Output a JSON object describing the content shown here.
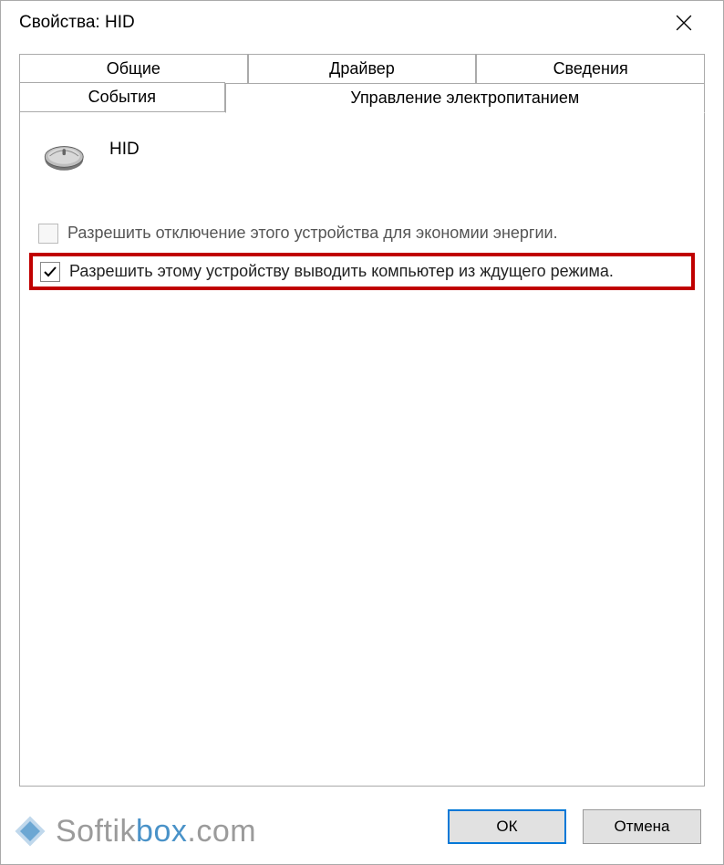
{
  "titlebar": {
    "title": "Свойства: HID"
  },
  "tabs": {
    "general": "Общие",
    "driver": "Драйвер",
    "details": "Сведения",
    "events": "События",
    "power": "Управление электропитанием"
  },
  "device": {
    "name": "HID"
  },
  "options": {
    "allow_turn_off": {
      "checked": false,
      "label": "Разрешить отключение этого устройства для экономии энергии."
    },
    "allow_wake": {
      "checked": true,
      "label": "Разрешить этому устройству выводить компьютер из ждущего режима."
    }
  },
  "buttons": {
    "ok": "ОК",
    "cancel": "Отмена"
  },
  "watermark": {
    "soft": "Softik",
    "box": "box",
    "com": ".com"
  }
}
